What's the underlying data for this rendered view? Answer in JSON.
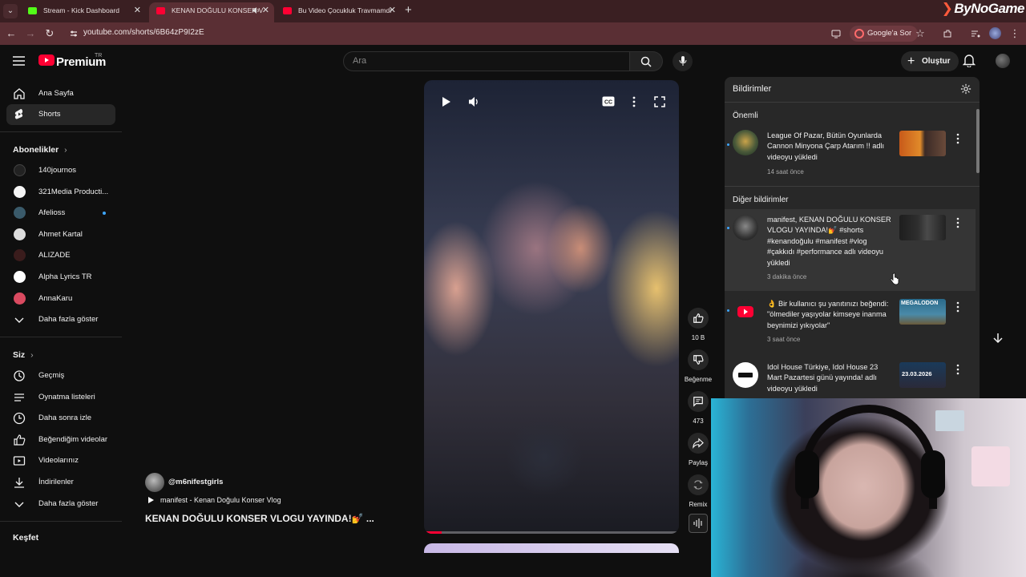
{
  "browser": {
    "tabs": [
      {
        "title": "Stream - Kick Dashboard",
        "color": "#53fc18"
      },
      {
        "title": "KENAN DOĞULU KONSER V",
        "color": "#ff0033"
      },
      {
        "title": "Bu Video Çocukluk Travmamdı",
        "color": "#ff0033"
      }
    ],
    "url": "youtube.com/shorts/6B64zP9I2zE",
    "ask_google": "Google'a Sor",
    "brand": "ByNoGame"
  },
  "header": {
    "logo_text": "Premium",
    "region": "TR",
    "search_placeholder": "Ara",
    "create_label": "Oluştur"
  },
  "sidebar": {
    "main": [
      {
        "label": "Ana Sayfa",
        "icon": "home-icon"
      },
      {
        "label": "Shorts",
        "icon": "shorts-icon"
      }
    ],
    "subscriptions_title": "Abonelikler",
    "subscriptions": [
      {
        "label": "140journos",
        "color": "#222222"
      },
      {
        "label": "321Media Producti...",
        "color": "#f5f5f5"
      },
      {
        "label": "Afelioss",
        "color": "#3a5a6a"
      },
      {
        "label": "Ahmet Kartal",
        "color": "#dddddd"
      },
      {
        "label": "ALIZADE",
        "color": "#3a1c1c"
      },
      {
        "label": "Alpha Lyrics TR",
        "color": "#ffffff"
      },
      {
        "label": "AnnaKaru",
        "color": "#d94a60"
      }
    ],
    "show_more": "Daha fazla göster",
    "you_title": "Siz",
    "you": [
      {
        "label": "Geçmiş",
        "icon": "history-icon"
      },
      {
        "label": "Oynatma listeleri",
        "icon": "playlist-icon"
      },
      {
        "label": "Daha sonra izle",
        "icon": "watch-later-icon"
      },
      {
        "label": "Beğendiğim videolar",
        "icon": "liked-icon"
      },
      {
        "label": "Videolarınız",
        "icon": "your-videos-icon"
      },
      {
        "label": "İndirilenler",
        "icon": "download-icon"
      }
    ],
    "show_more_2": "Daha fazla göster",
    "explore_title": "Keşfet"
  },
  "short": {
    "channel": "@m6nifestgirls",
    "song": "manifest - Kenan Doğulu Konser Vlog",
    "title": "KENAN DOĞULU KONSER VLOGU YAYINDA!💅 ...",
    "progress": 0.07,
    "likes": "10 B",
    "dislike_label": "Beğenme",
    "comments": "473",
    "share_label": "Paylaş",
    "remix_label": "Remix"
  },
  "notifications": {
    "title": "Bildirimler",
    "important_title": "Önemli",
    "other_title": "Diğer bildirimler",
    "items": [
      {
        "text": "League Of Pazar, Bütün Oyunlarda Cannon Minyona Çarp Atarım !! adlı videoyu yükledi",
        "time": "14 saat önce"
      },
      {
        "text": "manifest, KENAN DOĞULU KONSER VLOGU YAYINDA!💅 #shorts #kenandoğulu #manifest #vlog #çakkıdı #performance adlı videoyu yükledi",
        "time": "3 dakika önce"
      },
      {
        "text": "👌 Bir kullanıcı şu yanıtınızı beğendi: \"ölmediler yaşıyolar kimseye inanma beynimizi yıkıyolar\"",
        "time": "3 saat önce",
        "thumb_label": "MEGALODON"
      },
      {
        "text": "Idol House Türkiye, Idol House 23 Mart Pazartesi günü yayında! adlı videoyu yükledi",
        "time": "",
        "thumb_label": "23.03.2026"
      }
    ]
  }
}
